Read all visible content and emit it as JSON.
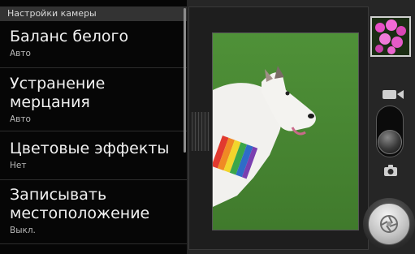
{
  "settings": {
    "header": "Настройки камеры",
    "items": [
      {
        "title": "Баланс белого",
        "value": "Авто"
      },
      {
        "title": "Устранение мерцания",
        "value": "Авто"
      },
      {
        "title": "Цветовые эффекты",
        "value": "Нет"
      },
      {
        "title": "Записывать местоположение",
        "value": "Выкл."
      }
    ]
  },
  "controls": {
    "mode": "photo",
    "icons": [
      "video-camera-icon",
      "photo-camera-icon",
      "shutter-icon",
      "gallery-thumbnail"
    ]
  },
  "colors": {
    "panel_bg": "#060606",
    "header_bg": "#333333",
    "accent": "#4c8f34"
  }
}
